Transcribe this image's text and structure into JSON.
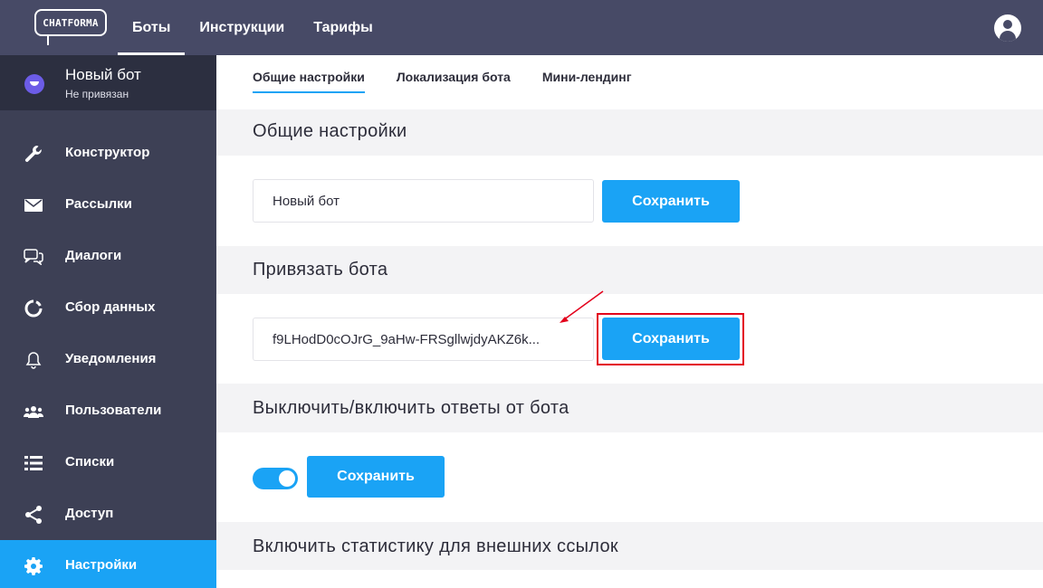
{
  "brand": {
    "logo_text": "CHATFORMA"
  },
  "header": {
    "nav": [
      {
        "label": "Боты",
        "active": true
      },
      {
        "label": "Инструкции",
        "active": false
      },
      {
        "label": "Тарифы",
        "active": false
      }
    ],
    "profile_icon": "user-circle-icon"
  },
  "sidebar": {
    "bot": {
      "name": "Новый бот",
      "status": "Не привязан",
      "icon": "bot-chat-icon"
    },
    "items": [
      {
        "label": "Конструктор",
        "icon": "wrench-icon"
      },
      {
        "label": "Рассылки",
        "icon": "envelope-icon"
      },
      {
        "label": "Диалоги",
        "icon": "chat-bubbles-icon"
      },
      {
        "label": "Сбор данных",
        "icon": "ring-icon"
      },
      {
        "label": "Уведомления",
        "icon": "bell-icon"
      },
      {
        "label": "Пользователи",
        "icon": "users-icon"
      },
      {
        "label": "Списки",
        "icon": "list-icon"
      },
      {
        "label": "Доступ",
        "icon": "share-icon"
      },
      {
        "label": "Настройки",
        "icon": "gear-icon",
        "active": true
      }
    ]
  },
  "tabs": [
    {
      "label": "Общие настройки",
      "active": true
    },
    {
      "label": "Локализация бота",
      "active": false
    },
    {
      "label": "Мини-лендинг",
      "active": false
    }
  ],
  "sections": {
    "general": {
      "title": "Общие настройки",
      "bot_name_value": "Новый бот",
      "save_label": "Сохранить"
    },
    "bind": {
      "title": "Привязать бота",
      "token_value": "f9LHodD0cOJrG_9aHw-FRSgllwjdyAKZ6k...",
      "save_label": "Сохранить"
    },
    "toggle_replies": {
      "title": "Выключить/включить ответы от бота",
      "enabled": true,
      "save_label": "Сохранить"
    },
    "stats": {
      "title": "Включить статистику для внешних ссылок"
    }
  },
  "colors": {
    "accent": "#1aa3f5",
    "topbar": "#474a66",
    "sidebar": "#3d4055",
    "annotation": "#e3001b"
  }
}
